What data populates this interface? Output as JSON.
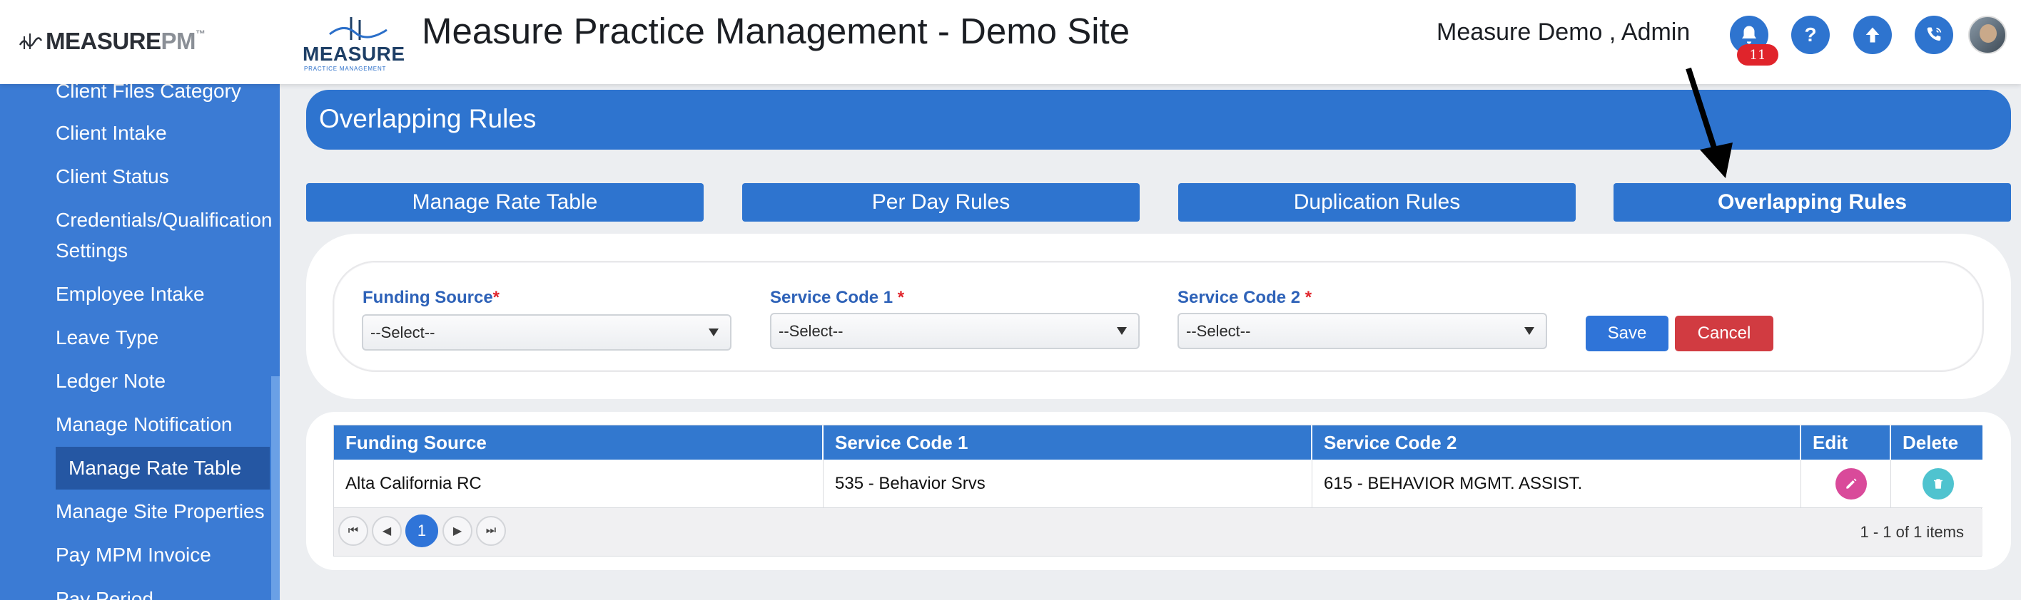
{
  "header": {
    "brand_part1": "MEASURE",
    "brand_part2": "PM",
    "brand_tm": "™",
    "logo_word": "MEASURE",
    "logo_sub": "PRACTICE MANAGEMENT",
    "site_title": "Measure Practice Management - Demo Site",
    "user_name": "Measure Demo , Admin",
    "notification_count": "11",
    "icons": [
      "bell-icon",
      "help-icon",
      "upload-icon",
      "phone-icon",
      "avatar"
    ],
    "help_glyph": "?",
    "accent_color": "#2e74cf"
  },
  "sidebar": {
    "items": [
      {
        "label": "Client Files Category"
      },
      {
        "label": "Client Intake"
      },
      {
        "label": "Client Status"
      },
      {
        "label": "Credentials/Qualification"
      },
      {
        "label": "Settings"
      },
      {
        "label": "Employee Intake"
      },
      {
        "label": "Leave Type"
      },
      {
        "label": "Ledger Note"
      },
      {
        "label": "Manage Notification"
      },
      {
        "label": "Manage Rate Table",
        "active": true
      },
      {
        "label": "Manage Site Properties"
      },
      {
        "label": "Pay MPM Invoice"
      },
      {
        "label": "Pay Period"
      }
    ],
    "bg_color": "#3b7bd4",
    "active_color": "#2557a3"
  },
  "page": {
    "title": "Overlapping Rules"
  },
  "tabs": [
    {
      "label": "Manage Rate Table"
    },
    {
      "label": "Per Day Rules"
    },
    {
      "label": "Duplication Rules"
    },
    {
      "label": "Overlapping Rules",
      "active": true
    }
  ],
  "form": {
    "funding_source": {
      "label": "Funding Source",
      "required_mark": "*",
      "value": "--Select--"
    },
    "service_code_1": {
      "label": "Service Code 1 ",
      "required_mark": "*",
      "value": "--Select--"
    },
    "service_code_2": {
      "label": "Service Code 2 ",
      "required_mark": "*",
      "value": "--Select--"
    },
    "save_label": "Save",
    "cancel_label": "Cancel"
  },
  "grid": {
    "columns": [
      "Funding Source",
      "Service Code 1",
      "Service Code 2",
      "Edit",
      "Delete"
    ],
    "rows": [
      {
        "funding_source": "Alta California RC",
        "service_code_1": "535 - Behavior Srvs",
        "service_code_2": "615 - BEHAVIOR MGMT. ASSIST."
      }
    ],
    "pager": {
      "current_page": "1",
      "info": "1 - 1 of 1 items"
    }
  }
}
